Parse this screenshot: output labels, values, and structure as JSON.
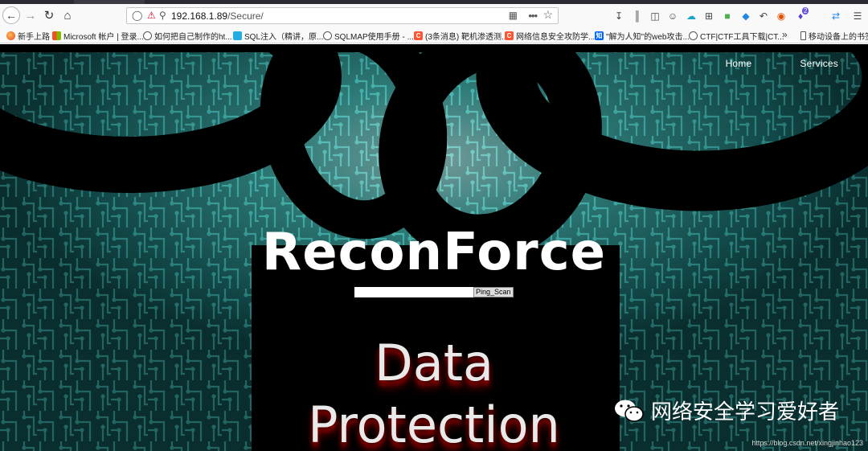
{
  "browser": {
    "url_host": "192.168.1.89",
    "url_path": "/Secure/",
    "toolbar_badge": "2",
    "bookmarks": [
      {
        "label": "新手上路",
        "icon": "firefox"
      },
      {
        "label": "Microsoft 帐户 | 登录...",
        "icon": "ms"
      },
      {
        "label": "如何把自己制作的ht...",
        "icon": "globe"
      },
      {
        "label": "SQL注入（精讲，原...",
        "icon": "bili"
      },
      {
        "label": "SQLMAP使用手册 - ...",
        "icon": "globe"
      },
      {
        "label": "(3条消息) 靶机渗透测...",
        "icon": "csdn"
      },
      {
        "label": "网络信息安全攻防学...",
        "icon": "csdn"
      },
      {
        "label": "\"解为人知\"的web攻击...",
        "icon": "zhihu"
      },
      {
        "label": "CTF|CTF工具下载|CT...",
        "icon": "globe"
      }
    ],
    "mobile_bookmarks": "移动设备上的书签"
  },
  "page": {
    "nav": {
      "home": "Home",
      "services": "Services"
    },
    "title": "ReconForce",
    "ping_button": "Ping_Scan",
    "hero_text_line1": "Data",
    "hero_text_line2": "Protection"
  },
  "overlay": {
    "watermark": "网络安全学习爱好者",
    "csdn_url": "https://blog.csdn.net/xingjinhao123"
  },
  "colors": {
    "circuit": "#3fa9a5",
    "insecure": "#d70022"
  }
}
